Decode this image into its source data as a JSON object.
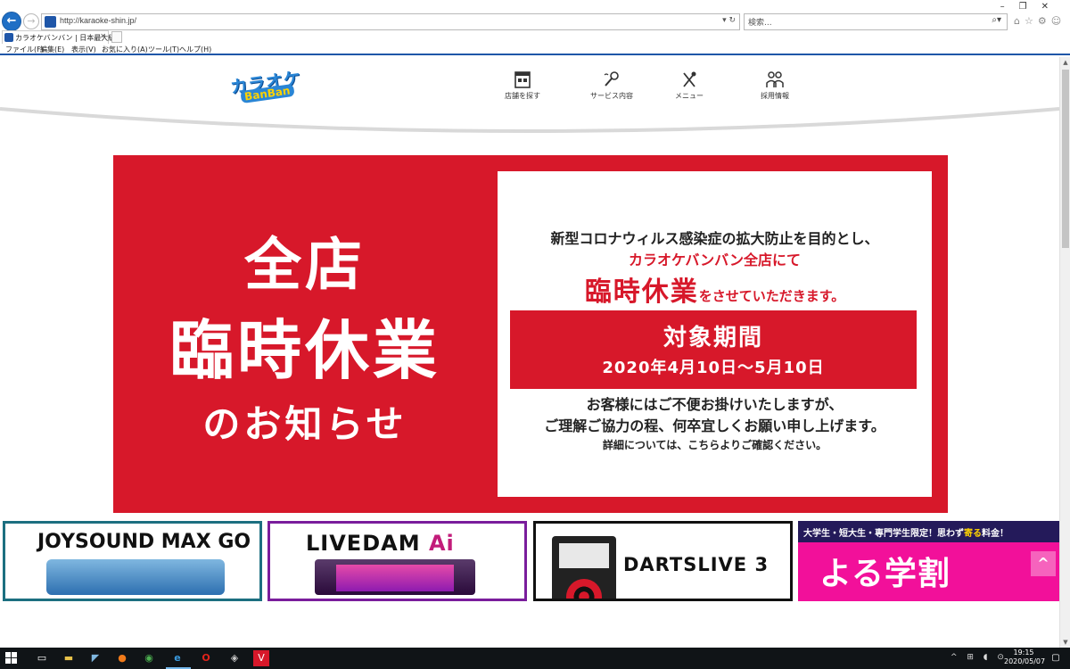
{
  "browser": {
    "url": "http://karaoke-shin.jp/",
    "search_placeholder": "検索...",
    "tab_title": "カラオケバンバン | 日本最大級...",
    "menu": [
      "ファイル(F)",
      "編集(E)",
      "表示(V)",
      "お気に入り(A)",
      "ツール(T)",
      "ヘルプ(H)"
    ]
  },
  "site": {
    "logo": "カラオケ",
    "logo_sub": "BanBan",
    "nav": [
      {
        "label": "店舗を探す",
        "icon": "store-icon"
      },
      {
        "label": "サービス内容",
        "icon": "microphone-icon"
      },
      {
        "label": "メニュー",
        "icon": "fork-knife-icon"
      },
      {
        "label": "採用情報",
        "icon": "staff-icon"
      }
    ]
  },
  "notice": {
    "title_1": "全店",
    "title_2": "臨時休業",
    "title_3": "のお知らせ",
    "line_1": "新型コロナウィルス感染症の拡大防止を目的とし、",
    "line_2": "カラオケバンバン全店にて",
    "line_3_big": "臨時休業",
    "line_3_small": "をさせていただきます。",
    "period_title": "対象期間",
    "period_dates": "2020年4月10日〜5月10日",
    "line_4": "お客様にはご不便お掛けいたしますが、",
    "line_5": "ご理解ご協力の程、何卒宜しくお願い申し上げます。",
    "line_6": "詳細については、こちらよりご確認ください。",
    "accent_color": "#d7182a"
  },
  "cards": {
    "joysound": "JOYSOUND MAX GO",
    "livedam": "LIVEDAM",
    "livedam_ai": "Ai",
    "dartslive": "DARTSLIVE 3",
    "yorugaku_band_1": "大学生・短大生・専門学生限定！思わず",
    "yorugaku_band_hl": "寄る",
    "yorugaku_band_2": "料金！",
    "yorugaku_title": "よる学割"
  },
  "taskbar": {
    "time": "19:15",
    "date": "2020/05/07"
  }
}
